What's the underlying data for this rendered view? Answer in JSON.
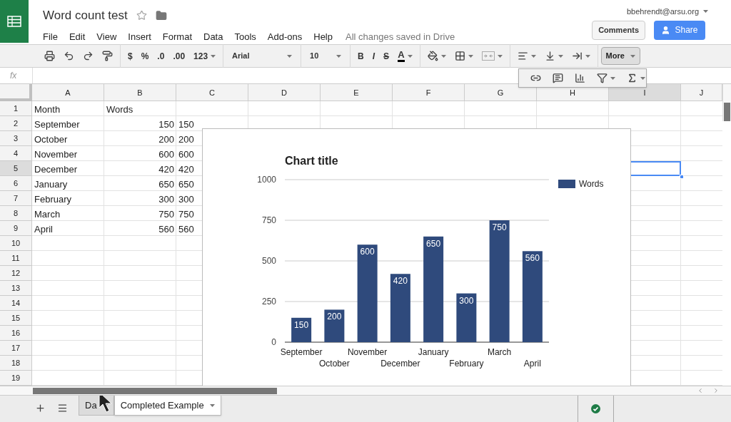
{
  "header": {
    "title": "Word count test",
    "menu": [
      "File",
      "Edit",
      "View",
      "Insert",
      "Format",
      "Data",
      "Tools",
      "Add-ons",
      "Help"
    ],
    "save_status": "All changes saved in Drive",
    "account": "bbehrendt@arsu.org",
    "comments_button": "Comments",
    "share_button": "Share"
  },
  "toolbar": {
    "currency": "$",
    "percent": "%",
    "decrease_decimals": ".0",
    "increase_decimals": ".00",
    "number_format": "123",
    "font": "Arial",
    "font_size": "10",
    "bold": "B",
    "italic": "I",
    "strikethrough": "S",
    "text_color": "A",
    "more": "More"
  },
  "formula_bar": {
    "label": "fx"
  },
  "sheet": {
    "columns": [
      {
        "label": "A",
        "selected": false
      },
      {
        "label": "B",
        "selected": false
      },
      {
        "label": "C",
        "selected": false
      },
      {
        "label": "D",
        "selected": false
      },
      {
        "label": "E",
        "selected": false
      },
      {
        "label": "F",
        "selected": false
      },
      {
        "label": "G",
        "selected": false
      },
      {
        "label": "H",
        "selected": false
      },
      {
        "label": "I",
        "selected": true
      },
      {
        "label": "J",
        "selected": false
      }
    ],
    "rows": [
      {
        "number": "1",
        "selected": false,
        "kind": "header",
        "cells": [
          "Month",
          "Words"
        ]
      },
      {
        "number": "2",
        "selected": false,
        "kind": "data",
        "cells": [
          "September",
          "150",
          "150"
        ]
      },
      {
        "number": "3",
        "selected": false,
        "kind": "data",
        "cells": [
          "October",
          "200",
          "200"
        ]
      },
      {
        "number": "4",
        "selected": false,
        "kind": "data",
        "cells": [
          "November",
          "600",
          "600"
        ]
      },
      {
        "number": "5",
        "selected": true,
        "kind": "data",
        "cells": [
          "December",
          "420",
          "420"
        ]
      },
      {
        "number": "6",
        "selected": false,
        "kind": "data",
        "cells": [
          "January",
          "650",
          "650"
        ]
      },
      {
        "number": "7",
        "selected": false,
        "kind": "data",
        "cells": [
          "February",
          "300",
          "300"
        ]
      },
      {
        "number": "8",
        "selected": false,
        "kind": "data",
        "cells": [
          "March",
          "750",
          "750"
        ]
      },
      {
        "number": "9",
        "selected": false,
        "kind": "data",
        "cells": [
          "April",
          "560",
          "560"
        ]
      },
      {
        "number": "10",
        "selected": false,
        "kind": "data",
        "cells": []
      },
      {
        "number": "11",
        "selected": false,
        "kind": "data",
        "cells": []
      },
      {
        "number": "12",
        "selected": false,
        "kind": "data",
        "cells": []
      },
      {
        "number": "13",
        "selected": false,
        "kind": "data",
        "cells": []
      },
      {
        "number": "14",
        "selected": false,
        "kind": "data",
        "cells": []
      },
      {
        "number": "15",
        "selected": false,
        "kind": "data",
        "cells": []
      },
      {
        "number": "16",
        "selected": false,
        "kind": "data",
        "cells": []
      },
      {
        "number": "17",
        "selected": false,
        "kind": "data",
        "cells": []
      },
      {
        "number": "18",
        "selected": false,
        "kind": "data",
        "cells": []
      },
      {
        "number": "19",
        "selected": false,
        "kind": "data",
        "cells": []
      }
    ]
  },
  "chart": {
    "chart_data": {
      "type": "bar",
      "title": "Chart title",
      "categories": [
        "September",
        "October",
        "November",
        "December",
        "January",
        "February",
        "March",
        "April"
      ],
      "series": [
        {
          "name": "Words",
          "color": "#2f4a7c",
          "values": [
            150,
            200,
            600,
            420,
            650,
            300,
            750,
            560
          ]
        }
      ],
      "ylim": [
        0,
        1000
      ],
      "yticks": [
        0,
        250,
        500,
        750,
        1000
      ],
      "grid": true,
      "data_labels": true
    }
  },
  "sheet_tabs": [
    {
      "label": "Da",
      "selected": false
    },
    {
      "label": "Completed Example",
      "selected": true
    }
  ]
}
